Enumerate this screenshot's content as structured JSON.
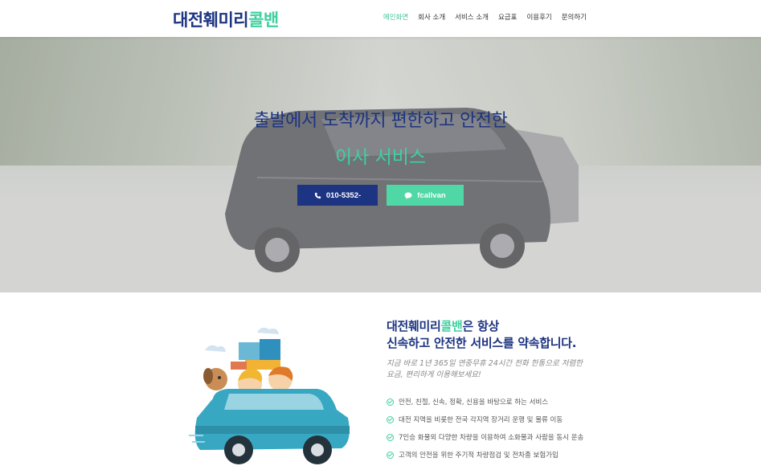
{
  "header": {
    "logo_part1": "대전훼미리",
    "logo_part2": "콜밴",
    "nav": [
      "메인화면",
      "회사 소개",
      "서비스 소개",
      "요금표",
      "이용후기",
      "문의하기"
    ]
  },
  "hero": {
    "title": "출발에서 도착까지 편한하고 안전한",
    "subtitle": "이사 서비스",
    "phone_button": "010-5352-",
    "phone_icon": "phone-icon",
    "kakao_button": "fcallvan",
    "kakao_icon": "chat-bubble-icon"
  },
  "about": {
    "title_part1": "대전훼미리",
    "title_part2": "콜밴",
    "title_part3": "은 항상",
    "title_line2": "신속하고 안전한 서비스를 약속합니다.",
    "description": "지금 바로 1년 365일 연중무휴 24시간 전화 한통으로 저렴한 요금, 편리하게 이용해보세요!",
    "features": [
      "안전, 친절, 신속, 정확, 신용을 바탕으로 하는 서비스",
      "대전 지역을 비롯한 전국 각지역 장거리 운행 및 물류 이동",
      "7인승 화물외 다양한 차량을 이용하여 소화물과 사람을 동시 운송",
      "고객의 안전을 위한 주기적 차량점검 및 전차종 보험가입"
    ]
  },
  "colors": {
    "primary": "#1c3481",
    "accent": "#3fd0a0"
  }
}
